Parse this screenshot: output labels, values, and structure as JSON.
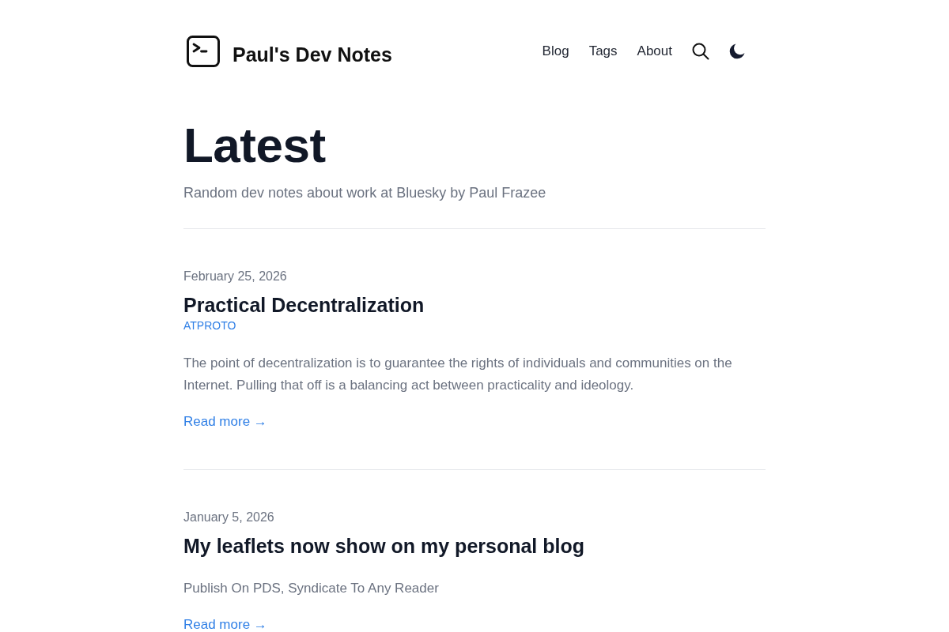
{
  "header": {
    "site_title": "Paul's Dev Notes",
    "nav": [
      {
        "label": "Blog"
      },
      {
        "label": "Tags"
      },
      {
        "label": "About"
      }
    ]
  },
  "page": {
    "title": "Latest",
    "subtitle": "Random dev notes about work at Bluesky by Paul Frazee"
  },
  "posts": [
    {
      "date": "February 25, 2026",
      "title": "Practical Decentralization",
      "tags": [
        "ATPROTO"
      ],
      "summary": "The point of decentralization is to guarantee the rights of individuals and communities on the Internet. Pulling that off is a balancing act between practicality and ideology.",
      "read_more": "Read more →"
    },
    {
      "date": "January 5, 2026",
      "title": "My leaflets now show on my personal blog",
      "summary": "Publish On PDS, Syndicate To Any Reader",
      "read_more": "Read more →"
    }
  ]
}
